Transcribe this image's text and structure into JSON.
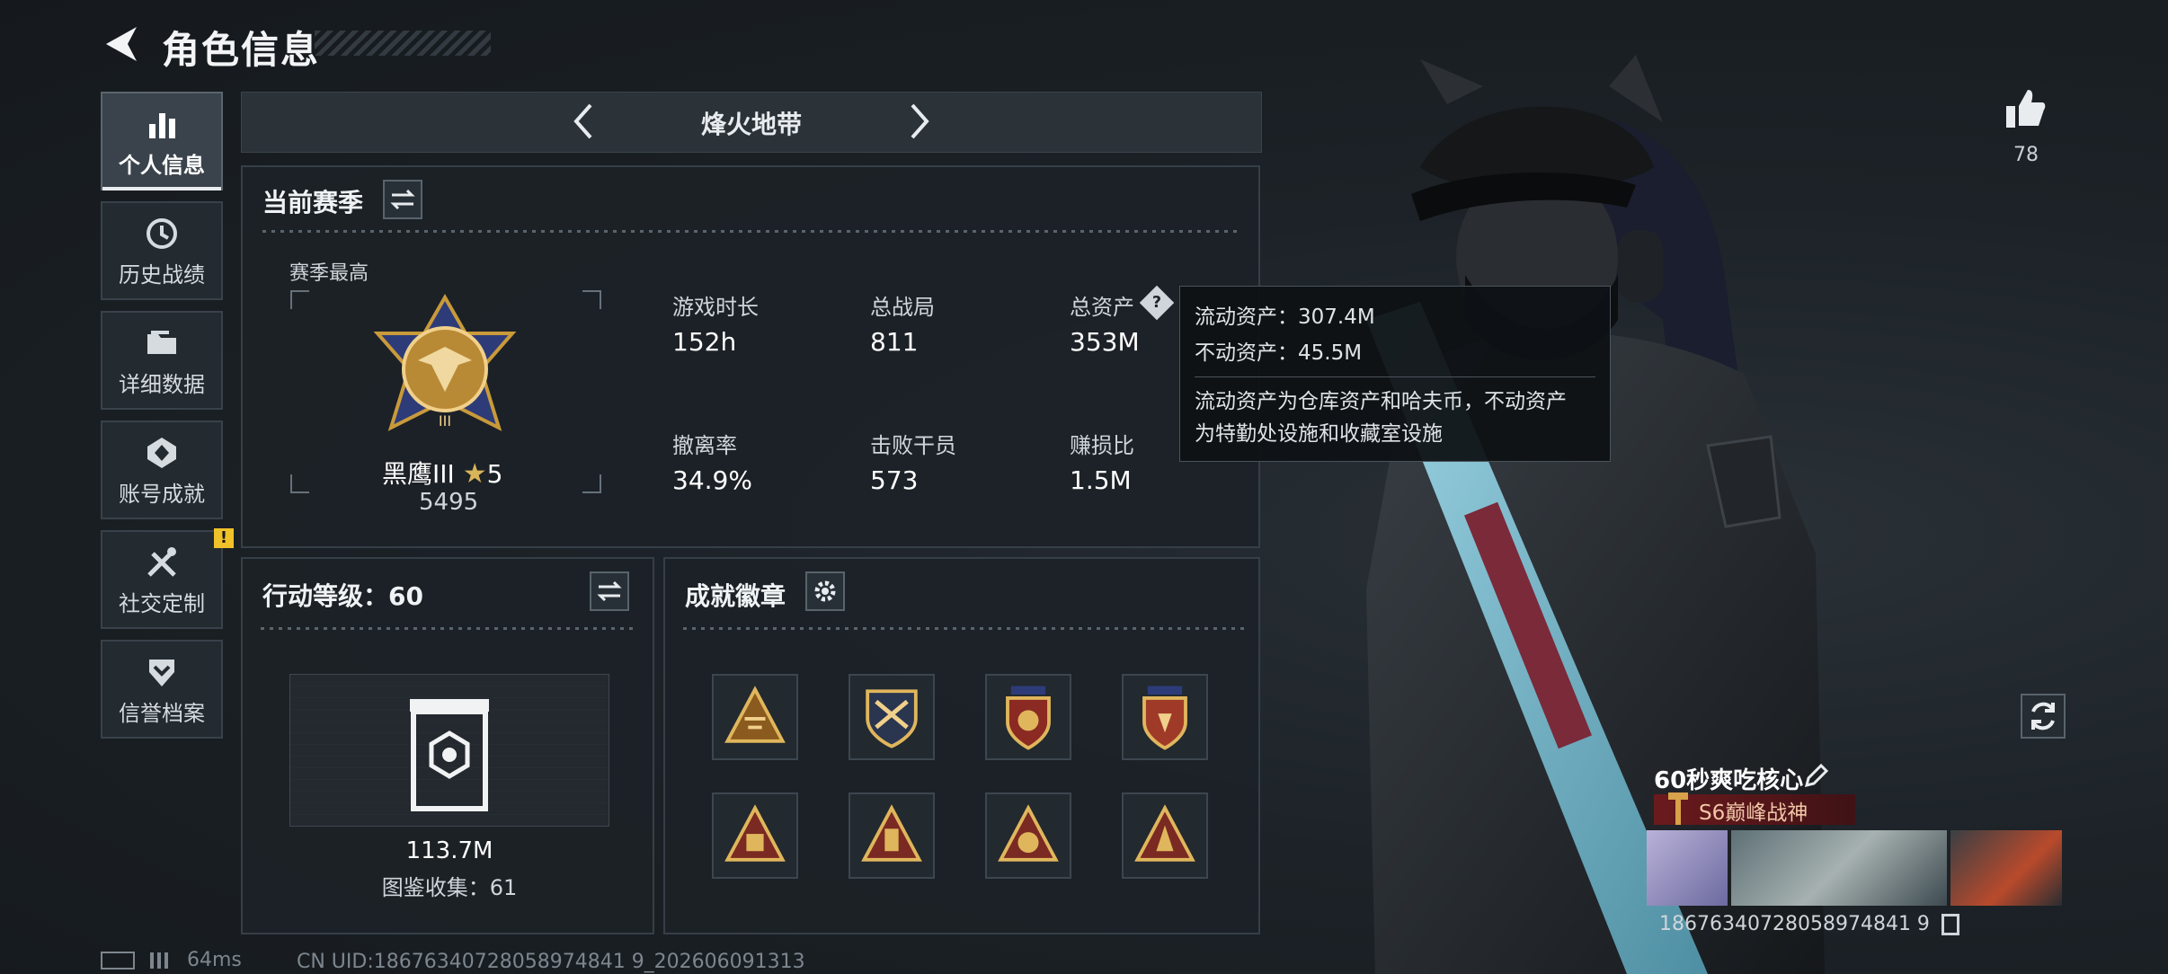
{
  "header": {
    "title": "角色信息"
  },
  "sidebar": {
    "items": [
      {
        "label": "个人信息",
        "icon": "bar-chart-icon",
        "active": true
      },
      {
        "label": "历史战绩",
        "icon": "history-clock-icon"
      },
      {
        "label": "详细数据",
        "icon": "folder-icon"
      },
      {
        "label": "账号成就",
        "icon": "achievement-icon"
      },
      {
        "label": "社交定制",
        "icon": "tools-icon",
        "alert": "!"
      },
      {
        "label": "信誉档案",
        "icon": "shield-chevron-icon"
      }
    ]
  },
  "mode_bar": {
    "name": "烽火地带"
  },
  "season": {
    "title": "当前赛季",
    "best_label": "赛季最高",
    "rank_name": "黑鹰III",
    "rank_stars": "5",
    "rank_points": "5495",
    "stats": [
      {
        "label": "游戏时长",
        "value": "152h"
      },
      {
        "label": "总战局",
        "value": "811"
      },
      {
        "label": "总资产",
        "value": "353M"
      },
      {
        "label": "撤离率",
        "value": "34.9%"
      },
      {
        "label": "击败干员",
        "value": "573"
      },
      {
        "label": "赚损比",
        "value": "1.5M"
      }
    ]
  },
  "tooltip": {
    "line1": "流动资产：307.4M",
    "line2": "不动资产：45.5M",
    "desc1": "流动资产为仓库资产和哈夫币，不动资产",
    "desc2": "为特勤处设施和收藏室设施"
  },
  "level": {
    "title": "行动等级：60",
    "value": "113.7M",
    "collection": "图鉴收集：61"
  },
  "badges": {
    "title": "成就徽章",
    "count": 8
  },
  "right": {
    "likes": "78",
    "player_name": "60秒爽吃核心",
    "rank_tag": "S6巅峰战神",
    "uid": "18676340728058974841 9"
  },
  "status": {
    "ping": "64ms",
    "uid_line": "CN UID:18676340728058974841 9_202606091313"
  },
  "colors": {
    "accent_gold": "#c99a3a",
    "tag_red": "#6b1a1d"
  }
}
